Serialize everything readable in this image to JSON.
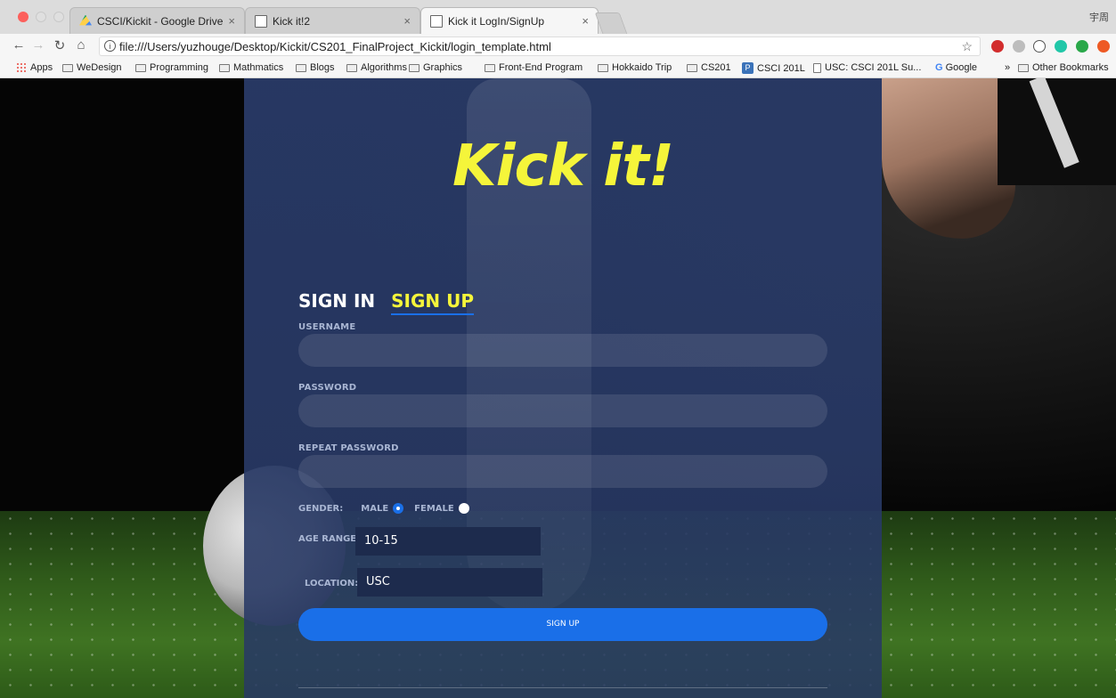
{
  "browser": {
    "tabs": [
      {
        "title": "CSCI/Kickit - Google Drive",
        "icon": "google-drive-icon"
      },
      {
        "title": "Kick it!2",
        "icon": "page-icon"
      },
      {
        "title": "Kick it LogIn/SignUp",
        "icon": "page-icon",
        "active": true
      }
    ],
    "user_label": "宇周",
    "url": "file:///Users/yuzhouge/Desktop/Kickit/CS201_FinalProject_Kickit/login_template.html",
    "bookmarks": [
      {
        "label": "Apps",
        "icon": "apps-icon"
      },
      {
        "label": "WeDesign",
        "icon": "folder-icon"
      },
      {
        "label": "Programming",
        "icon": "folder-icon"
      },
      {
        "label": "Mathmatics",
        "icon": "folder-icon"
      },
      {
        "label": "Blogs",
        "icon": "folder-icon"
      },
      {
        "label": "Algorithms",
        "icon": "folder-icon"
      },
      {
        "label": "Graphics",
        "icon": "folder-icon"
      },
      {
        "label": "Front-End Program",
        "icon": "folder-icon"
      },
      {
        "label": "Hokkaido Trip",
        "icon": "folder-icon"
      },
      {
        "label": "CS201",
        "icon": "folder-icon"
      },
      {
        "label": "CSCI 201L",
        "icon": "piazza-icon"
      },
      {
        "label": "USC: CSCI 201L Su...",
        "icon": "page-icon"
      },
      {
        "label": "Google",
        "icon": "google-icon"
      },
      {
        "label": "Other Bookmarks",
        "icon": "folder-icon"
      }
    ],
    "overflow_label": "»"
  },
  "page": {
    "logo": "Kick it!",
    "tabs": {
      "sign_in": "SIGN IN",
      "sign_up": "SIGN UP",
      "active": "sign_up"
    },
    "form": {
      "username_label": "USERNAME",
      "username_value": "",
      "password_label": "PASSWORD",
      "password_value": "",
      "repeat_password_label": "REPEAT PASSWORD",
      "repeat_password_value": "",
      "gender_label": "GENDER:",
      "gender_options": [
        "MALE",
        "FEMALE"
      ],
      "gender_selected": "MALE",
      "age_range_label": "AGE RANGE:",
      "age_range_value": "10-15",
      "location_label": "LOCATION:",
      "location_value": "USC",
      "submit_label": "SIGN UP"
    },
    "colors": {
      "accent": "#1a6fe8",
      "logo": "#f5f53a",
      "panel": "#283965"
    }
  }
}
